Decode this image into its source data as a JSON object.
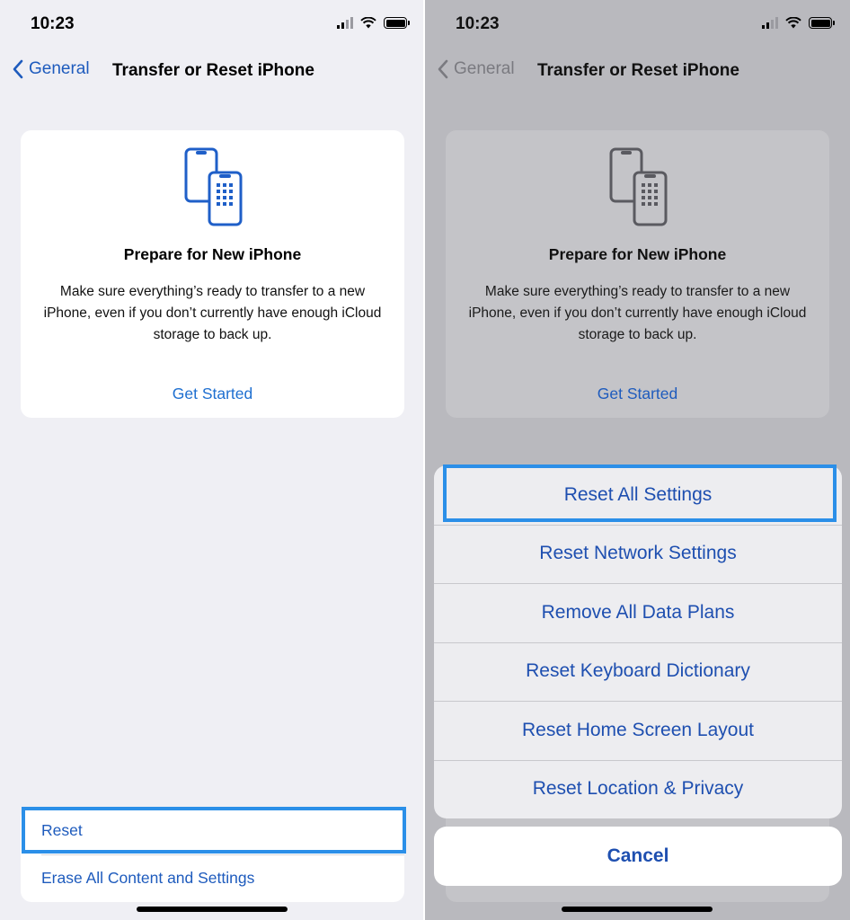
{
  "status": {
    "time": "10:23"
  },
  "nav": {
    "back_label": "General",
    "title": "Transfer or Reset iPhone"
  },
  "card": {
    "icon": "transfer-phones-icon",
    "title": "Prepare for New iPhone",
    "description": "Make sure everything’s ready to transfer to a new iPhone, even if you don’t currently have enough iCloud storage to back up.",
    "link": "Get Started"
  },
  "list": {
    "items": [
      "Reset",
      "Erase All Content and Settings"
    ]
  },
  "sheet": {
    "actions": [
      "Reset All Settings",
      "Reset Network Settings",
      "Remove All Data Plans",
      "Reset Keyboard Dictionary",
      "Reset Home Screen Layout",
      "Reset Location & Privacy"
    ],
    "cancel": "Cancel"
  },
  "colors": {
    "accent": "#1e5bbd",
    "highlight": "#2b8fe8",
    "background": "#efeff4"
  }
}
